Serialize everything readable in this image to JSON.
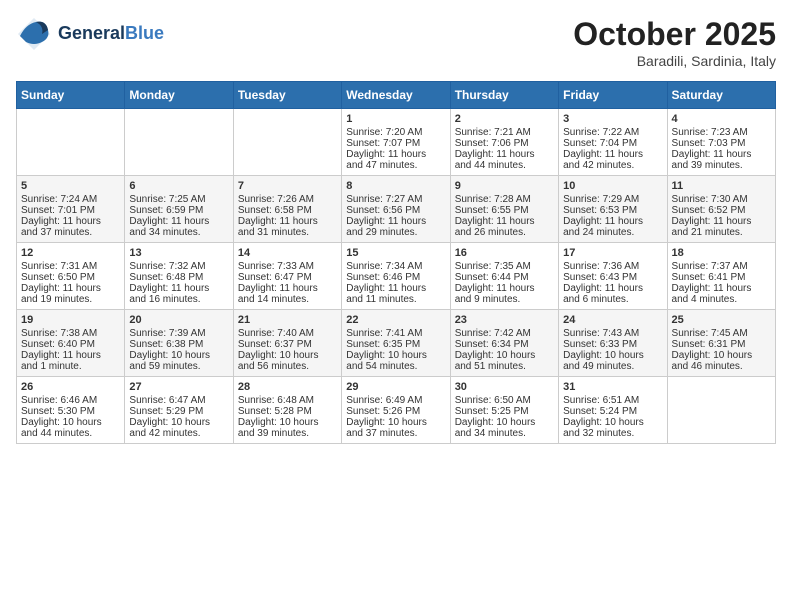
{
  "header": {
    "logo_line1": "General",
    "logo_line2": "Blue",
    "month": "October 2025",
    "location": "Baradili, Sardinia, Italy"
  },
  "weekdays": [
    "Sunday",
    "Monday",
    "Tuesday",
    "Wednesday",
    "Thursday",
    "Friday",
    "Saturday"
  ],
  "weeks": [
    [
      {
        "day": "",
        "lines": []
      },
      {
        "day": "",
        "lines": []
      },
      {
        "day": "",
        "lines": []
      },
      {
        "day": "1",
        "lines": [
          "Sunrise: 7:20 AM",
          "Sunset: 7:07 PM",
          "Daylight: 11 hours",
          "and 47 minutes."
        ]
      },
      {
        "day": "2",
        "lines": [
          "Sunrise: 7:21 AM",
          "Sunset: 7:06 PM",
          "Daylight: 11 hours",
          "and 44 minutes."
        ]
      },
      {
        "day": "3",
        "lines": [
          "Sunrise: 7:22 AM",
          "Sunset: 7:04 PM",
          "Daylight: 11 hours",
          "and 42 minutes."
        ]
      },
      {
        "day": "4",
        "lines": [
          "Sunrise: 7:23 AM",
          "Sunset: 7:03 PM",
          "Daylight: 11 hours",
          "and 39 minutes."
        ]
      }
    ],
    [
      {
        "day": "5",
        "lines": [
          "Sunrise: 7:24 AM",
          "Sunset: 7:01 PM",
          "Daylight: 11 hours",
          "and 37 minutes."
        ]
      },
      {
        "day": "6",
        "lines": [
          "Sunrise: 7:25 AM",
          "Sunset: 6:59 PM",
          "Daylight: 11 hours",
          "and 34 minutes."
        ]
      },
      {
        "day": "7",
        "lines": [
          "Sunrise: 7:26 AM",
          "Sunset: 6:58 PM",
          "Daylight: 11 hours",
          "and 31 minutes."
        ]
      },
      {
        "day": "8",
        "lines": [
          "Sunrise: 7:27 AM",
          "Sunset: 6:56 PM",
          "Daylight: 11 hours",
          "and 29 minutes."
        ]
      },
      {
        "day": "9",
        "lines": [
          "Sunrise: 7:28 AM",
          "Sunset: 6:55 PM",
          "Daylight: 11 hours",
          "and 26 minutes."
        ]
      },
      {
        "day": "10",
        "lines": [
          "Sunrise: 7:29 AM",
          "Sunset: 6:53 PM",
          "Daylight: 11 hours",
          "and 24 minutes."
        ]
      },
      {
        "day": "11",
        "lines": [
          "Sunrise: 7:30 AM",
          "Sunset: 6:52 PM",
          "Daylight: 11 hours",
          "and 21 minutes."
        ]
      }
    ],
    [
      {
        "day": "12",
        "lines": [
          "Sunrise: 7:31 AM",
          "Sunset: 6:50 PM",
          "Daylight: 11 hours",
          "and 19 minutes."
        ]
      },
      {
        "day": "13",
        "lines": [
          "Sunrise: 7:32 AM",
          "Sunset: 6:48 PM",
          "Daylight: 11 hours",
          "and 16 minutes."
        ]
      },
      {
        "day": "14",
        "lines": [
          "Sunrise: 7:33 AM",
          "Sunset: 6:47 PM",
          "Daylight: 11 hours",
          "and 14 minutes."
        ]
      },
      {
        "day": "15",
        "lines": [
          "Sunrise: 7:34 AM",
          "Sunset: 6:46 PM",
          "Daylight: 11 hours",
          "and 11 minutes."
        ]
      },
      {
        "day": "16",
        "lines": [
          "Sunrise: 7:35 AM",
          "Sunset: 6:44 PM",
          "Daylight: 11 hours",
          "and 9 minutes."
        ]
      },
      {
        "day": "17",
        "lines": [
          "Sunrise: 7:36 AM",
          "Sunset: 6:43 PM",
          "Daylight: 11 hours",
          "and 6 minutes."
        ]
      },
      {
        "day": "18",
        "lines": [
          "Sunrise: 7:37 AM",
          "Sunset: 6:41 PM",
          "Daylight: 11 hours",
          "and 4 minutes."
        ]
      }
    ],
    [
      {
        "day": "19",
        "lines": [
          "Sunrise: 7:38 AM",
          "Sunset: 6:40 PM",
          "Daylight: 11 hours",
          "and 1 minute."
        ]
      },
      {
        "day": "20",
        "lines": [
          "Sunrise: 7:39 AM",
          "Sunset: 6:38 PM",
          "Daylight: 10 hours",
          "and 59 minutes."
        ]
      },
      {
        "day": "21",
        "lines": [
          "Sunrise: 7:40 AM",
          "Sunset: 6:37 PM",
          "Daylight: 10 hours",
          "and 56 minutes."
        ]
      },
      {
        "day": "22",
        "lines": [
          "Sunrise: 7:41 AM",
          "Sunset: 6:35 PM",
          "Daylight: 10 hours",
          "and 54 minutes."
        ]
      },
      {
        "day": "23",
        "lines": [
          "Sunrise: 7:42 AM",
          "Sunset: 6:34 PM",
          "Daylight: 10 hours",
          "and 51 minutes."
        ]
      },
      {
        "day": "24",
        "lines": [
          "Sunrise: 7:43 AM",
          "Sunset: 6:33 PM",
          "Daylight: 10 hours",
          "and 49 minutes."
        ]
      },
      {
        "day": "25",
        "lines": [
          "Sunrise: 7:45 AM",
          "Sunset: 6:31 PM",
          "Daylight: 10 hours",
          "and 46 minutes."
        ]
      }
    ],
    [
      {
        "day": "26",
        "lines": [
          "Sunrise: 6:46 AM",
          "Sunset: 5:30 PM",
          "Daylight: 10 hours",
          "and 44 minutes."
        ]
      },
      {
        "day": "27",
        "lines": [
          "Sunrise: 6:47 AM",
          "Sunset: 5:29 PM",
          "Daylight: 10 hours",
          "and 42 minutes."
        ]
      },
      {
        "day": "28",
        "lines": [
          "Sunrise: 6:48 AM",
          "Sunset: 5:28 PM",
          "Daylight: 10 hours",
          "and 39 minutes."
        ]
      },
      {
        "day": "29",
        "lines": [
          "Sunrise: 6:49 AM",
          "Sunset: 5:26 PM",
          "Daylight: 10 hours",
          "and 37 minutes."
        ]
      },
      {
        "day": "30",
        "lines": [
          "Sunrise: 6:50 AM",
          "Sunset: 5:25 PM",
          "Daylight: 10 hours",
          "and 34 minutes."
        ]
      },
      {
        "day": "31",
        "lines": [
          "Sunrise: 6:51 AM",
          "Sunset: 5:24 PM",
          "Daylight: 10 hours",
          "and 32 minutes."
        ]
      },
      {
        "day": "",
        "lines": []
      }
    ]
  ]
}
